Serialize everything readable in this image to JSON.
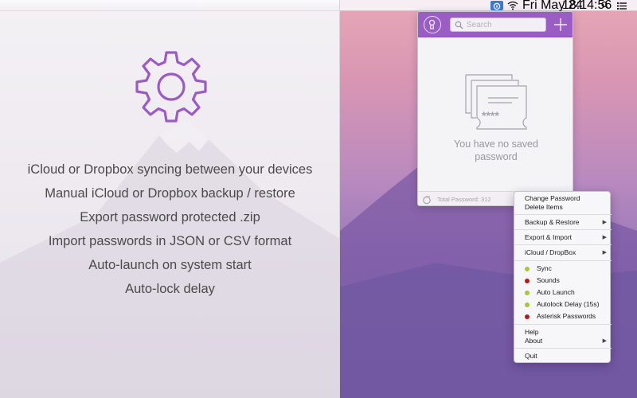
{
  "promo": {
    "features": [
      "iCloud or Dropbox syncing between your devices",
      "Manual iCloud or Dropbox backup / restore",
      "Export password protected .zip",
      "Import passwords in JSON or CSV format",
      "Auto-launch on system start",
      "Auto-lock delay"
    ],
    "gear_icon": "gear-icon"
  },
  "menubar": {
    "date": "Fri May 24",
    "time": "18:14:56",
    "icons": [
      "app-icon",
      "wifi-icon",
      "spotlight-icon",
      "notification-center-icon"
    ]
  },
  "popover": {
    "search_placeholder": "Search",
    "empty_message_line1": "You have no saved",
    "empty_message_line2": "password",
    "footer_label": "Total Password: 312",
    "accent": "#9a5dc4"
  },
  "menu": {
    "change_password": "Change Password",
    "delete_items": "Delete Items",
    "backup_restore": "Backup & Restore",
    "export_import": "Export & Import",
    "icloud_dropbox": "iCloud / DropBox",
    "toggles": [
      {
        "label": "Sync",
        "color": "#a6c63c"
      },
      {
        "label": "Sounds",
        "color": "#b41c1c"
      },
      {
        "label": "Auto Launch",
        "color": "#a6c63c"
      },
      {
        "label": "Autolock Delay (15s)",
        "color": "#a6c63c"
      },
      {
        "label": "Asterisk Passwords",
        "color": "#b41c1c"
      }
    ],
    "help": "Help",
    "about": "About",
    "quit": "Quit",
    "submenu_arrow": "▶"
  }
}
